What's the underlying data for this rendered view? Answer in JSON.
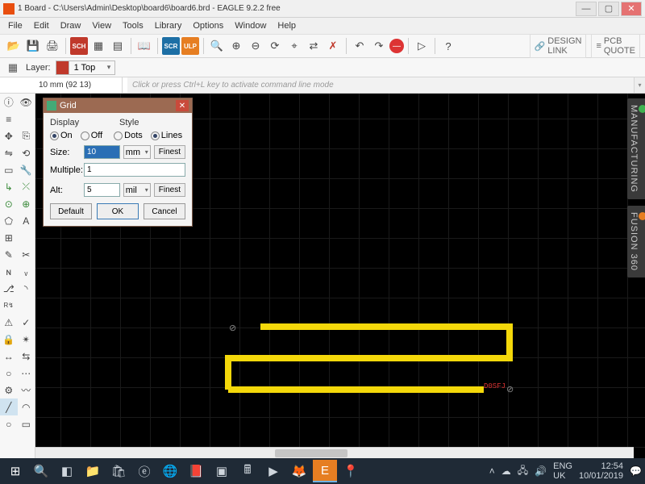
{
  "window": {
    "title": "1 Board - C:\\Users\\Admin\\Desktop\\board6\\board6.brd - EAGLE 9.2.2 free"
  },
  "menu": {
    "items": [
      "File",
      "Edit",
      "Draw",
      "View",
      "Tools",
      "Library",
      "Options",
      "Window",
      "Help"
    ]
  },
  "toolbar_right": {
    "design_link": "DESIGN\nLINK",
    "pcb_quote": "PCB\nQUOTE"
  },
  "layer_row": {
    "label": "Layer:",
    "selected": "1 Top"
  },
  "coord": {
    "text": "10 mm (92 13)"
  },
  "cmdline": {
    "placeholder": "Click or press Ctrl+L key to activate command line mode"
  },
  "right_tabs": {
    "manufacturing": "MANUFACTURING",
    "fusion": "FUSION 360"
  },
  "canvas": {
    "ref_label": "D0SFJ"
  },
  "dialog": {
    "title": "Grid",
    "display_label": "Display",
    "style_label": "Style",
    "on": "On",
    "off": "Off",
    "dots": "Dots",
    "lines": "Lines",
    "size_label": "Size:",
    "size_value": "10",
    "size_unit": "mm",
    "finest": "Finest",
    "multiple_label": "Multiple:",
    "multiple_value": "1",
    "alt_label": "Alt:",
    "alt_value": "5",
    "alt_unit": "mil",
    "default": "Default",
    "ok": "OK",
    "cancel": "Cancel"
  },
  "taskbar": {
    "lang": "ENG",
    "kb": "UK",
    "time": "12:54",
    "date": "10/01/2019"
  }
}
